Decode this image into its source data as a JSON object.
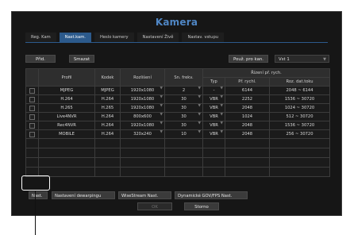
{
  "dialog": {
    "title": "Kamera"
  },
  "tabs": [
    {
      "label": "Reg. Kam"
    },
    {
      "label": "Nast.kam."
    },
    {
      "label": "Heslo kamery"
    },
    {
      "label": "Nastavení Živě"
    },
    {
      "label": "Nastav. vstupu"
    }
  ],
  "toolbar": {
    "add_label": "Přid.",
    "delete_label": "Smazat",
    "apply_label": "Použ. pro kan.",
    "profile_select": "Vst 1"
  },
  "table": {
    "headers": {
      "profile": "Profil",
      "codec": "Kodek",
      "resolution": "Rozlišení",
      "frame_rate": "Sn. frekv.",
      "bitrate_control": "Řízení př. rych.",
      "type": "Typ",
      "rate": "Př. rychl.",
      "range": "Roz. dat.toku"
    },
    "rows": [
      {
        "profile": "MJPEG",
        "codec": "MJPEG",
        "resolution": "1920x1080",
        "fps": "2",
        "type": "-",
        "rate": "6144",
        "range": "2048 ~ 6144"
      },
      {
        "profile": "H.264",
        "codec": "H.264",
        "resolution": "1920x1080",
        "fps": "30",
        "type": "VBR",
        "rate": "2252",
        "range": "1536 ~ 30720"
      },
      {
        "profile": "H.265",
        "codec": "H.265",
        "resolution": "1920x1080",
        "fps": "30",
        "type": "VBR",
        "rate": "2048",
        "range": "1024 ~ 30720"
      },
      {
        "profile": "Live4NVR",
        "codec": "H.264",
        "resolution": "800x600",
        "fps": "30",
        "type": "VBR",
        "rate": "1024",
        "range": "512 ~ 30720"
      },
      {
        "profile": "Rec4NVR",
        "codec": "H.264",
        "resolution": "1920x1080",
        "fps": "30",
        "type": "VBR",
        "rate": "2048",
        "range": "1536 ~ 30720"
      },
      {
        "profile": "MOBILE",
        "codec": "H.264",
        "resolution": "320x240",
        "fps": "10",
        "type": "VBR",
        "rate": "2048",
        "range": "256 ~ 30720"
      }
    ]
  },
  "bottom": {
    "nast_label": "Nast.",
    "dewarping_label": "Nastavení dewarpingu",
    "wisestream_label": "WiseStream Nast.",
    "dynamic_gov_label": "Dynamické GOV/FPS Nast.",
    "ok_label": "OK",
    "cancel_label": "Storno"
  },
  "colors": {
    "accent": "#2c5a8c",
    "title": "#4f86c4",
    "background": "#161616"
  }
}
